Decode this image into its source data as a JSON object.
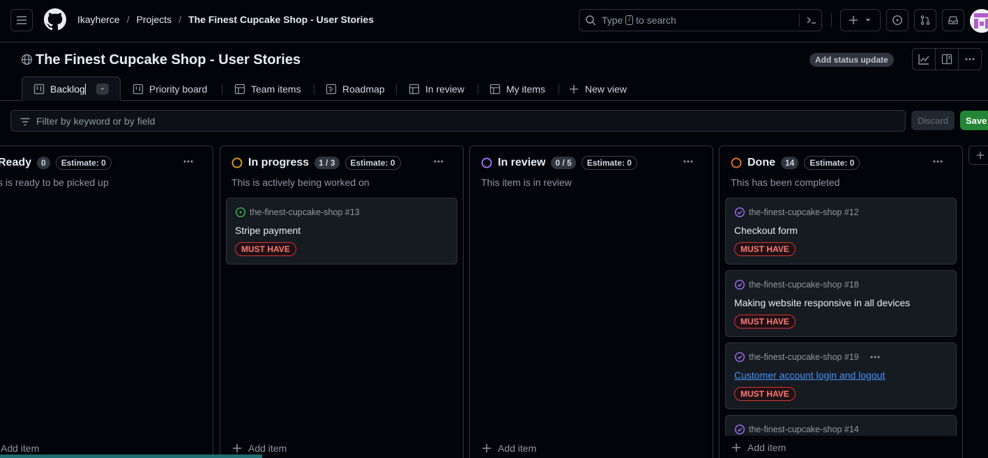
{
  "header": {
    "breadcrumb": {
      "owner": "Ikayherce",
      "projects": "Projects",
      "current": "The Finest Cupcake Shop - User Stories",
      "sep": "/"
    },
    "search": {
      "prefix": "Type",
      "slash": "/",
      "suffix": "to search"
    },
    "icons": [
      "hamburger-icon",
      "github-logo",
      "search-icon",
      "terminal-icon",
      "plus-icon",
      "issues-icon",
      "pull-requests-icon",
      "inbox-icon"
    ]
  },
  "project": {
    "title": "The Finest Cupcake Shop - User Stories",
    "status_update": "Add status update"
  },
  "tabs": [
    {
      "label": "Backlog",
      "icon": "board-icon",
      "active": true
    },
    {
      "label": "Priority board",
      "icon": "board-icon"
    },
    {
      "label": "Team items",
      "icon": "table-icon"
    },
    {
      "label": "Roadmap",
      "icon": "roadmap-icon"
    },
    {
      "label": "In review",
      "icon": "table-icon"
    },
    {
      "label": "My items",
      "icon": "table-icon"
    },
    {
      "label": "New view",
      "icon": "plus-icon"
    }
  ],
  "filter": {
    "placeholder": "Filter by keyword or by field",
    "discard": "Discard",
    "save": "Save"
  },
  "columns": [
    {
      "name": "Ready",
      "count": "0",
      "estimate": "Estimate: 0",
      "description": "s is ready to be picked up",
      "status_color": "#3fb950",
      "add_item": "Add item"
    },
    {
      "name": "In progress",
      "count": "1 / 3",
      "estimate": "Estimate: 0",
      "description": "This is actively being worked on",
      "status_color": "#d29922",
      "add_item": "Add item"
    },
    {
      "name": "In review",
      "count": "0 / 5",
      "estimate": "Estimate: 0",
      "description": "This item is in review",
      "status_color": "#a371f7",
      "add_item": "Add item"
    },
    {
      "name": "Done",
      "count": "14",
      "estimate": "Estimate: 0",
      "description": "This has been completed",
      "status_color": "#db6d28",
      "add_item": "Add item"
    }
  ],
  "cards": {
    "in_progress": [
      {
        "repo": "the-finest-cupcake-shop #13",
        "title": "Stripe payment",
        "label": "MUST HAVE",
        "state": "open"
      }
    ],
    "done": [
      {
        "repo": "the-finest-cupcake-shop #12",
        "title": "Checkout form",
        "label": "MUST HAVE",
        "state": "closed"
      },
      {
        "repo": "the-finest-cupcake-shop #18",
        "title": "Making website responsive in all devices",
        "label": "MUST HAVE",
        "state": "closed"
      },
      {
        "repo": "the-finest-cupcake-shop #19",
        "title": "Customer account login and logout",
        "label": "MUST HAVE",
        "state": "closed",
        "hovered": true
      },
      {
        "repo": "the-finest-cupcake-shop #14",
        "title": "",
        "label": "",
        "state": "closed"
      }
    ]
  },
  "colors": {
    "background": "#010409",
    "border": "#30363d",
    "accent_green": "#238636",
    "link": "#4493f8",
    "label_red": "#ff7b72"
  }
}
